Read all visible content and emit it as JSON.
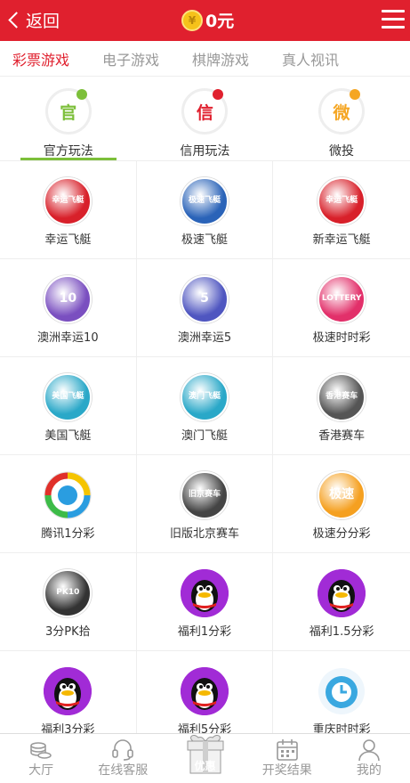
{
  "header": {
    "back_label": "返回",
    "coin_symbol": "¥",
    "balance": "0元"
  },
  "category_tabs": [
    {
      "label": "彩票游戏",
      "active": true
    },
    {
      "label": "电子游戏",
      "active": false
    },
    {
      "label": "棋牌游戏",
      "active": false
    },
    {
      "label": "真人视讯",
      "active": false
    }
  ],
  "mode_tabs": [
    {
      "label": "官方玩法",
      "icon_text": "官",
      "color": "#7cbf3a",
      "dot_color": "#7cbf3a",
      "active": true
    },
    {
      "label": "信用玩法",
      "icon_text": "信",
      "color": "#e0202e",
      "dot_color": "#e0202e",
      "active": false
    },
    {
      "label": "微投",
      "icon_text": "微",
      "color": "#f5a623",
      "dot_color": "#f5a623",
      "active": false
    }
  ],
  "games": [
    {
      "label": "幸运飞艇",
      "icon": "lucky-airship-icon",
      "bg": "#d8202a",
      "badge": "幸运飞艇"
    },
    {
      "label": "极速飞艇",
      "icon": "speed-airship-icon",
      "bg": "#2a63b8",
      "badge": "极速飞艇"
    },
    {
      "label": "新幸运飞艇",
      "icon": "new-lucky-airship-icon",
      "bg": "#d8202a",
      "badge": "幸运飞艇"
    },
    {
      "label": "澳洲幸运10",
      "icon": "australia-lucky10-icon",
      "bg": "#7a4fc0",
      "badge": "10"
    },
    {
      "label": "澳洲幸运5",
      "icon": "australia-lucky5-icon",
      "bg": "#4f56c0",
      "badge": "5"
    },
    {
      "label": "极速时时彩",
      "icon": "speed-ssc-icon",
      "bg": "#e2306a",
      "badge": "LOTTERY"
    },
    {
      "label": "美国飞艇",
      "icon": "usa-airship-icon",
      "bg": "#2aa8c8",
      "badge": "美国飞艇"
    },
    {
      "label": "澳门飞艇",
      "icon": "macau-airship-icon",
      "bg": "#2aa8c8",
      "badge": "澳门飞艇"
    },
    {
      "label": "香港赛车",
      "icon": "hk-racing-icon",
      "bg": "#555555",
      "badge": "香港赛车"
    },
    {
      "label": "腾讯1分彩",
      "icon": "tencent-icon",
      "bg": "#ffffff",
      "badge": ""
    },
    {
      "label": "旧版北京赛车",
      "icon": "beijing-racing-icon",
      "bg": "#444444",
      "badge": "旧京赛车"
    },
    {
      "label": "极速分分彩",
      "icon": "speed-ffc-icon",
      "bg": "#f5a020",
      "badge": "极速"
    },
    {
      "label": "3分PK拾",
      "icon": "pk10-icon",
      "bg": "#333333",
      "badge": "PK10"
    },
    {
      "label": "福利1分彩",
      "icon": "penguin-icon",
      "bg": "#a020d0",
      "badge": ""
    },
    {
      "label": "福利1.5分彩",
      "icon": "penguin-icon",
      "bg": "#a020d0",
      "badge": ""
    },
    {
      "label": "福利3分彩",
      "icon": "penguin-icon",
      "bg": "#a020d0",
      "badge": ""
    },
    {
      "label": "福利5分彩",
      "icon": "penguin-icon",
      "bg": "#a020d0",
      "badge": ""
    },
    {
      "label": "重庆时时彩",
      "icon": "chongqing-ssc-icon",
      "bg": "#3aa8e0",
      "badge": ""
    }
  ],
  "bottom_nav": [
    {
      "label": "大厅",
      "icon": "lobby-icon"
    },
    {
      "label": "在线客服",
      "icon": "customer-service-icon"
    },
    {
      "label": "优惠",
      "icon": "gift-icon"
    },
    {
      "label": "开奖结果",
      "icon": "calendar-icon"
    },
    {
      "label": "我的",
      "icon": "user-icon"
    }
  ]
}
